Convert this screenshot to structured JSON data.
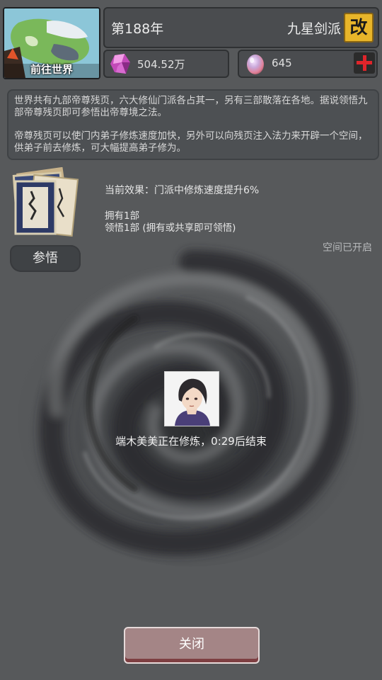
{
  "header": {
    "world_button_label": "前往世界",
    "year": "第188年",
    "sect_name": "九星剑派",
    "rename_label": "改"
  },
  "resources": {
    "spirit_stone": "504.52万",
    "spirit_egg": "645"
  },
  "description": {
    "paragraph1": "世界共有九部帝尊残页，六大修仙门派各占其一，另有三部散落在各地。据说领悟九部帝尊残页即可参悟出帝尊境之法。",
    "paragraph2": "帝尊残页可以使门内弟子修炼速度加快，另外可以向残页注入法力来开辟一个空间，供弟子前去修炼，可大幅提高弟子修为。"
  },
  "effect": {
    "current": "当前效果：门派中修炼速度提升6%",
    "owned": "拥有1部",
    "comprehended": "领悟1部 (拥有或共享即可领悟)"
  },
  "comprehend_button": "参悟",
  "space_status": "空间已开启",
  "cultivating_status": "端木美美正在修炼，0:29后结束",
  "close_button": "关闭",
  "icons": {
    "spirit_stone": "pink-crystal-icon",
    "spirit_egg": "iridescent-egg-icon",
    "add": "red-plus-icon",
    "map": "world-map-icon",
    "books": "scripture-pages-icon"
  },
  "colors": {
    "rename_button": "#e8b52a",
    "plus_icon": "#e0252b",
    "close_button": "#a48586"
  }
}
